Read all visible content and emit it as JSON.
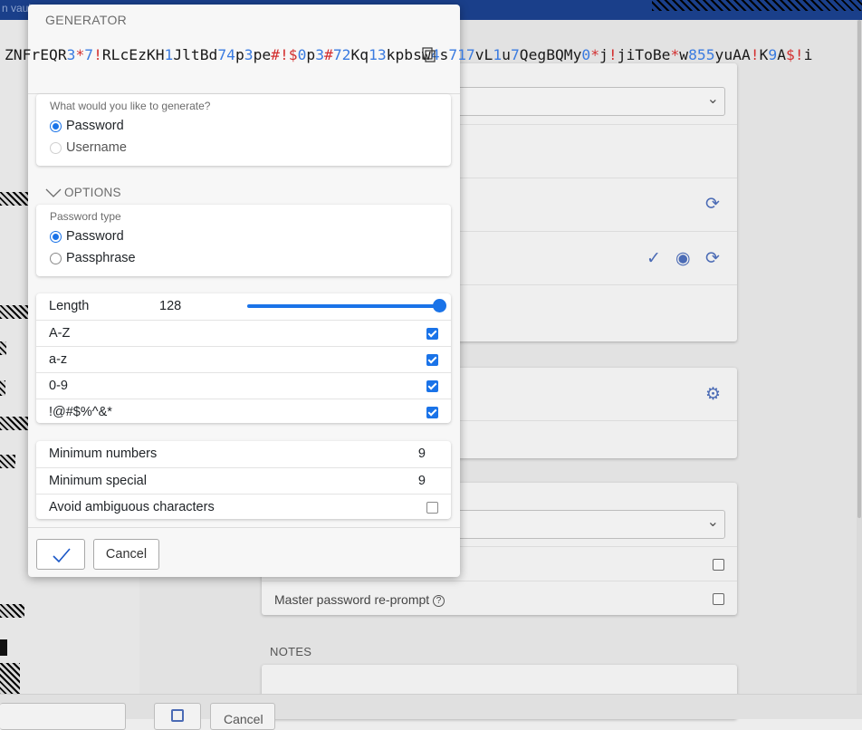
{
  "background": {
    "breadcrumb": "n vault",
    "master_reprompt_label": "Master password re-prompt",
    "notes_heading": "NOTES",
    "footer_cancel": "Cancel"
  },
  "modal": {
    "title": "GENERATOR",
    "password_segments": [
      {
        "t": "ZNFrEQR",
        "k": "a"
      },
      {
        "t": "3",
        "k": "n"
      },
      {
        "t": "*",
        "k": "s"
      },
      {
        "t": "7",
        "k": "n"
      },
      {
        "t": "!",
        "k": "s"
      },
      {
        "t": "RLcEzKH",
        "k": "a"
      },
      {
        "t": "1",
        "k": "n"
      },
      {
        "t": "JltBd",
        "k": "a"
      },
      {
        "t": "74",
        "k": "n"
      },
      {
        "t": "p",
        "k": "a"
      },
      {
        "t": "3",
        "k": "n"
      },
      {
        "t": "pe",
        "k": "a"
      },
      {
        "t": "#!$",
        "k": "s"
      },
      {
        "t": "0",
        "k": "n"
      },
      {
        "t": "p",
        "k": "a"
      },
      {
        "t": "3",
        "k": "n"
      },
      {
        "t": "#",
        "k": "s"
      },
      {
        "t": "72",
        "k": "n"
      },
      {
        "t": "Kq",
        "k": "a"
      },
      {
        "t": "13",
        "k": "n"
      },
      {
        "t": "kpbsw",
        "k": "a"
      },
      {
        "t": "4",
        "k": "n"
      },
      {
        "t": "s",
        "k": "a"
      },
      {
        "t": "717",
        "k": "n"
      },
      {
        "t": "vL",
        "k": "a"
      },
      {
        "t": "1",
        "k": "n"
      },
      {
        "t": "u",
        "k": "a"
      },
      {
        "t": "7",
        "k": "n"
      },
      {
        "t": "QegBQMy",
        "k": "a"
      },
      {
        "t": "0",
        "k": "n"
      },
      {
        "t": "*",
        "k": "s"
      },
      {
        "t": "j",
        "k": "a"
      },
      {
        "t": "!",
        "k": "s"
      },
      {
        "t": "jiToBe",
        "k": "a"
      },
      {
        "t": "*",
        "k": "s"
      },
      {
        "t": "w",
        "k": "a"
      },
      {
        "t": "855",
        "k": "n"
      },
      {
        "t": "yuAA",
        "k": "a"
      },
      {
        "t": "!",
        "k": "s"
      },
      {
        "t": "K",
        "k": "a"
      },
      {
        "t": "9",
        "k": "n"
      },
      {
        "t": "A",
        "k": "a"
      },
      {
        "t": "$!",
        "k": "s"
      },
      {
        "t": "i",
        "k": "a"
      }
    ],
    "colors": {
      "numbers": "#3a7be0",
      "specials": "#d32f2f",
      "accent": "#1a73e8"
    },
    "generate_panel": {
      "label": "What would you like to generate?",
      "options": [
        {
          "label": "Password",
          "selected": true
        },
        {
          "label": "Username",
          "selected": false
        }
      ]
    },
    "options_toggle": "OPTIONS",
    "type_panel": {
      "label": "Password type",
      "options": [
        {
          "label": "Password",
          "selected": true
        },
        {
          "label": "Passphrase",
          "selected": false
        }
      ]
    },
    "length": {
      "label": "Length",
      "value": "128",
      "slider_fraction": 1.0
    },
    "char_sets": [
      {
        "label": "A-Z",
        "checked": true
      },
      {
        "label": "a-z",
        "checked": true
      },
      {
        "label": "0-9",
        "checked": true
      },
      {
        "label": "!@#$%^&*",
        "checked": true
      }
    ],
    "minimums": {
      "numbers_label": "Minimum numbers",
      "numbers_value": "9",
      "special_label": "Minimum special",
      "special_value": "9",
      "ambiguous_label": "Avoid ambiguous characters",
      "ambiguous_checked": false
    },
    "cancel_label": "Cancel"
  }
}
